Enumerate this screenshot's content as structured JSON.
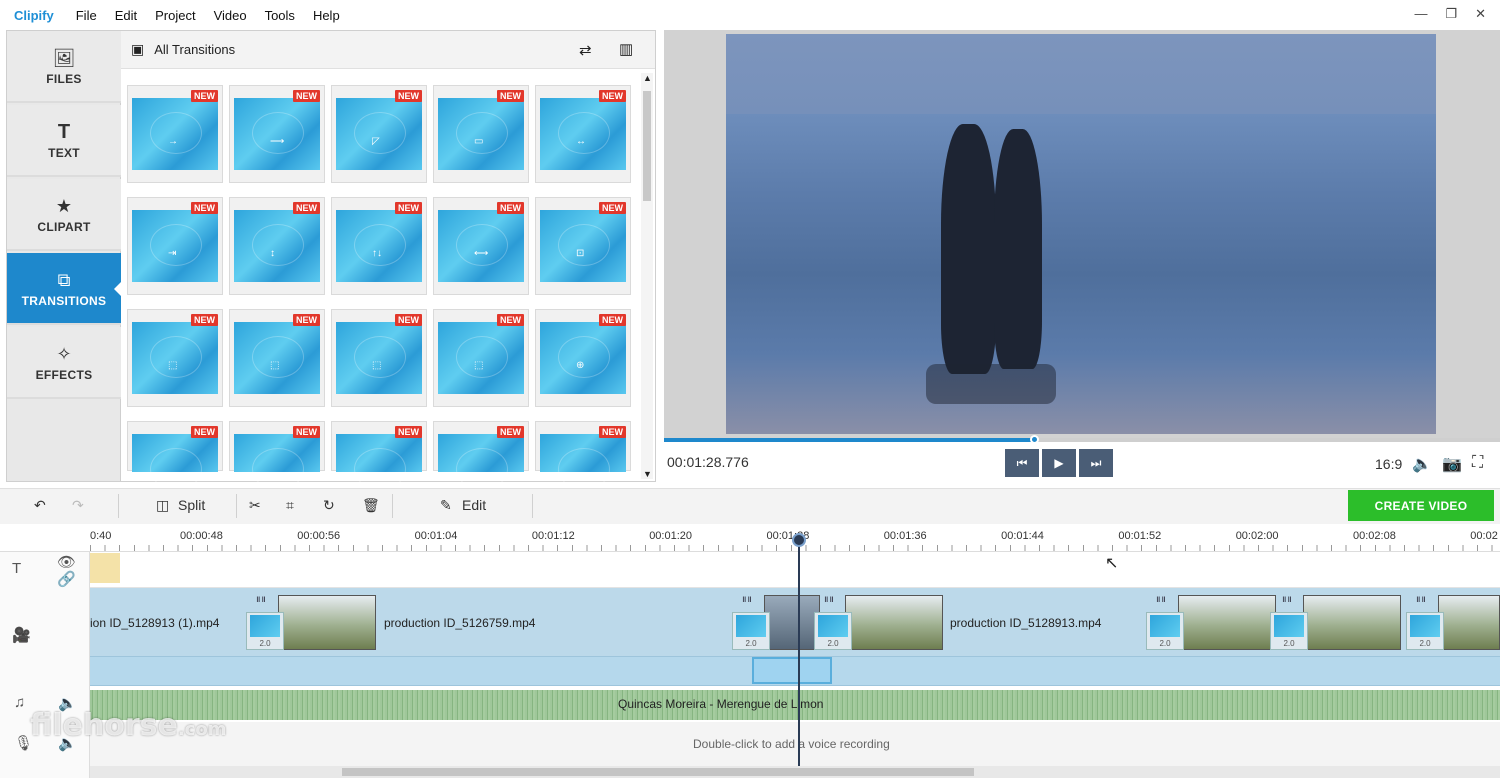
{
  "app": {
    "logo": "Clipify"
  },
  "menu": [
    "File",
    "Edit",
    "Project",
    "Video",
    "Tools",
    "Help"
  ],
  "window_controls": [
    "—",
    "❐",
    "✕"
  ],
  "nav": [
    {
      "label": "FILES",
      "icon": "image-icon",
      "glyph": "🖼"
    },
    {
      "label": "TEXT",
      "icon": "text-icon",
      "glyph": "T"
    },
    {
      "label": "CLIPART",
      "icon": "star-icon",
      "glyph": "★"
    },
    {
      "label": "TRANSITIONS",
      "icon": "transitions-icon",
      "glyph": "⧉",
      "active": true
    },
    {
      "label": "EFFECTS",
      "icon": "magic-wand-icon",
      "glyph": "✧"
    }
  ],
  "transitions": {
    "header": "All Transitions",
    "badge": "NEW"
  },
  "player": {
    "time": "00:01:28.776",
    "aspect_ratio": "16:9",
    "progress": 0.443
  },
  "toolbar": {
    "split_label": "Split",
    "edit_label": "Edit",
    "create_label": "CREATE VIDEO"
  },
  "ruler": [
    "0:40",
    "00:00:48",
    "00:00:56",
    "00:01:04",
    "00:01:12",
    "00:01:20",
    "00:01:28",
    "00:01:36",
    "00:01:44",
    "00:01:52",
    "00:02:00",
    "00:02:08",
    "00:02"
  ],
  "clips": {
    "clip1": "ion ID_5128913 (1).mp4",
    "clip2": "production ID_5126759.mp4",
    "clip3": "production ID_5128913.mp4",
    "trans_value": "2.0"
  },
  "music": {
    "title": "Quincas Moreira - Merengue de Limon"
  },
  "voice": {
    "hint": "Double-click to add a voice recording"
  },
  "watermark": "filehorse.com"
}
